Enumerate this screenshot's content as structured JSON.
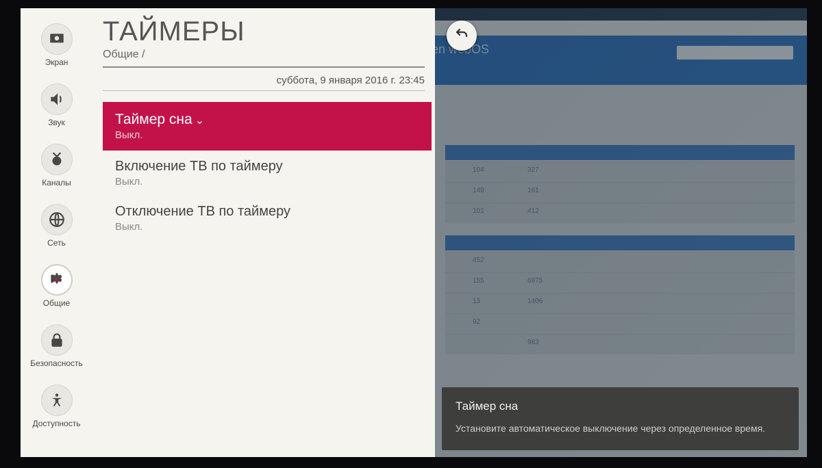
{
  "sidebar": {
    "items": [
      {
        "label": "Экран"
      },
      {
        "label": "Звук"
      },
      {
        "label": "Каналы"
      },
      {
        "label": "Сеть"
      },
      {
        "label": "Общие"
      },
      {
        "label": "Безопасность"
      },
      {
        "label": "Доступность"
      }
    ]
  },
  "header": {
    "title": "ТАЙМЕРЫ",
    "breadcrumb": "Общие /",
    "datetime": "суббота, 9 января 2016 г. 23:45"
  },
  "menu": {
    "items": [
      {
        "title": "Таймер сна",
        "value": "Выкл."
      },
      {
        "title": "Включение ТВ по таймеру",
        "value": "Выкл."
      },
      {
        "title": "Отключение ТВ по таймеру",
        "value": "Выкл."
      }
    ]
  },
  "tooltip": {
    "title": "Таймер сна",
    "text": "Установите автоматическое выключение через определенное время."
  },
  "background": {
    "site_title": "en webOS",
    "rows": [
      {
        "c1": "104",
        "c2": "327"
      },
      {
        "c1": "149",
        "c2": "161"
      },
      {
        "c1": "101",
        "c2": "412"
      },
      {
        "c1": "452",
        "c2": ""
      },
      {
        "c1": "155",
        "c2": "6975"
      },
      {
        "c1": "13",
        "c2": "1406"
      },
      {
        "c1": "92",
        "c2": ""
      },
      {
        "c1": "",
        "c2": "983"
      }
    ]
  }
}
